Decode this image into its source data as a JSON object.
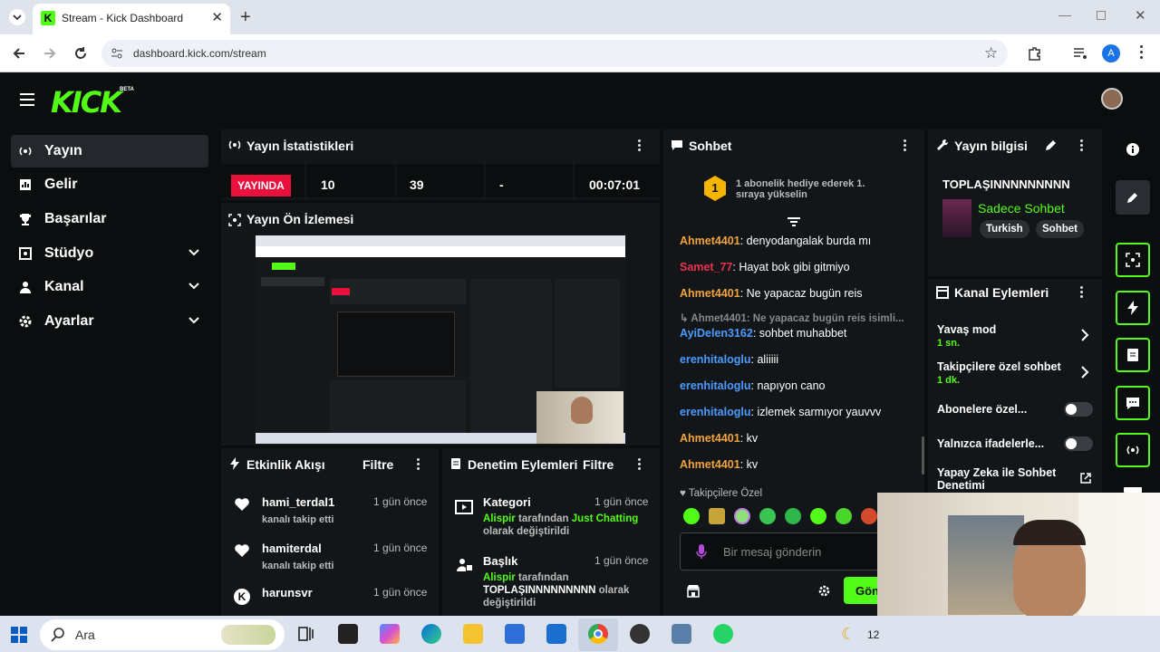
{
  "browser": {
    "tab_title": "Stream - Kick Dashboard",
    "url": "dashboard.kick.com/stream",
    "profile_letter": "A"
  },
  "kick": {
    "logo": "KICK",
    "beta": "BETA"
  },
  "sidebar": {
    "items": [
      {
        "label": "Yayın",
        "icon": "broadcast-icon",
        "active": true
      },
      {
        "label": "Gelir",
        "icon": "chart-icon"
      },
      {
        "label": "Başarılar",
        "icon": "trophy-icon"
      },
      {
        "label": "Stüdyo",
        "icon": "studio-icon",
        "expandable": true
      },
      {
        "label": "Kanal",
        "icon": "user-icon",
        "expandable": true
      },
      {
        "label": "Ayarlar",
        "icon": "gear-icon",
        "expandable": true
      }
    ]
  },
  "stats": {
    "title": "Yayın İstatistikleri",
    "live": "YAYINDA",
    "viewers": "10",
    "followers": "39",
    "subs": "-",
    "duration": "00:07:01"
  },
  "preview": {
    "title": "Yayın Ön İzlemesi"
  },
  "activity": {
    "title": "Etkinlik Akışı",
    "filter": "Filtre",
    "items": [
      {
        "name": "hami_terdal1",
        "text": "kanalı takip etti",
        "time": "1 gün önce"
      },
      {
        "name": "hamiterdal",
        "text": "kanalı takip etti",
        "time": "1 gün önce"
      },
      {
        "name": "harunsvr",
        "text": "",
        "time": "1 gün önce"
      }
    ]
  },
  "moderation": {
    "title": "Denetim Eylemleri",
    "filter": "Filtre",
    "items": [
      {
        "name": "Kategori",
        "time": "1 gün önce",
        "actor": "Alispir",
        "mid": " tarafından ",
        "value": "Just Chatting",
        "end": "olarak değiştirildi"
      },
      {
        "name": "Başlık",
        "time": "1 gün önce",
        "actor": "Alispir",
        "mid": " tarafından",
        "value": "TOPLAŞINNNNNNNNN",
        "end": " olarak",
        "end2": "değiştirildi"
      }
    ]
  },
  "chat": {
    "title": "Sohbet",
    "gift_badge": "1",
    "gift_line1": "1 abonelik hediye ederek 1.",
    "gift_line2": "sıraya yükselin",
    "messages": [
      {
        "user": "Ahmet4401",
        "color": "#f2a33a",
        "text": "denyodangalak burda mı"
      },
      {
        "user": "Samet_77",
        "color": "#e9334f",
        "text": "Hayat bok gibi gitmiyo"
      },
      {
        "user": "Ahmet4401",
        "color": "#f2a33a",
        "text": "Ne yapacaz bugün reis"
      },
      {
        "reply": "Ahmet4401: Ne yapacaz bugün reis isimli..."
      },
      {
        "user": "AyiDelen3162",
        "color": "#4a9bff",
        "text": "sohbet muhabbet"
      },
      {
        "user": "erenhitaloglu",
        "color": "#4a9bff",
        "text": "aliiiii"
      },
      {
        "user": "erenhitaloglu",
        "color": "#4a9bff",
        "text": "napıyon cano"
      },
      {
        "user": "erenhitaloglu",
        "color": "#4a9bff",
        "text": "izlemek sarmıyor yauvvv"
      },
      {
        "user": "Ahmet4401",
        "color": "#f2a33a",
        "text": "kv"
      },
      {
        "user": "Ahmet4401",
        "color": "#f2a33a",
        "text": "kv"
      }
    ],
    "emote_label": "Takipçilere Özel",
    "placeholder": "Bir mesaj gönderin",
    "send": "Gön"
  },
  "info": {
    "title": "Yayın bilgisi",
    "stream_title": "TOPLAŞINNNNNNNNN",
    "category": "Sadece Sohbet",
    "tags": [
      "Turkish",
      "Sohbet"
    ]
  },
  "channel_actions": {
    "title": "Kanal Eylemleri",
    "items": [
      {
        "label": "Yavaş mod",
        "value": "1 sn."
      },
      {
        "label": "Takipçilere özel sohbet",
        "value": "1 dk."
      },
      {
        "label": "Abonelere özel..."
      },
      {
        "label": "Yalnızca ifadelerle..."
      },
      {
        "label": "Yapay Zeka ile Sohbet",
        "label2": "Denetimi"
      }
    ]
  },
  "taskbar": {
    "search": "Ara",
    "clock": "12"
  }
}
